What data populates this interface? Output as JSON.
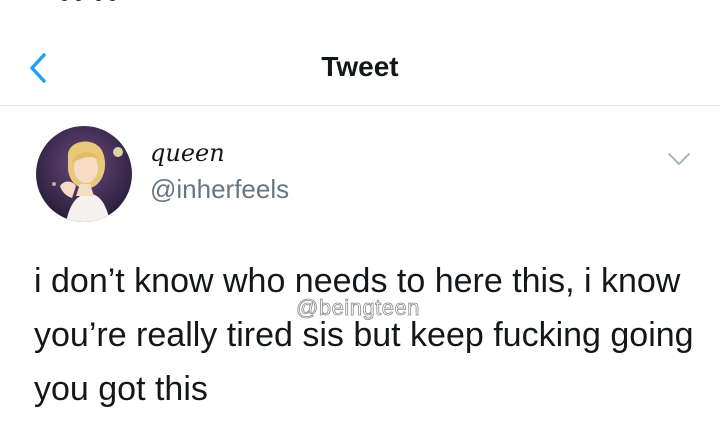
{
  "colors": {
    "accent": "#1da1f2",
    "text_primary": "#14171a",
    "text_secondary": "#657786",
    "divider": "#e1e8ed",
    "watermark_stroke": "#8a8a8a"
  },
  "nav": {
    "back_icon": "chevron-left-icon",
    "title": "Tweet"
  },
  "tweet": {
    "display_name": "queen",
    "handle": "@inherfeels",
    "caret_icon": "chevron-down-icon",
    "avatar_icon": "avatar-illustration",
    "text": "i don’t know who needs to here this, i know you’re really tired sis but keep fucking going you got this",
    "watermark": "@beingteen"
  }
}
